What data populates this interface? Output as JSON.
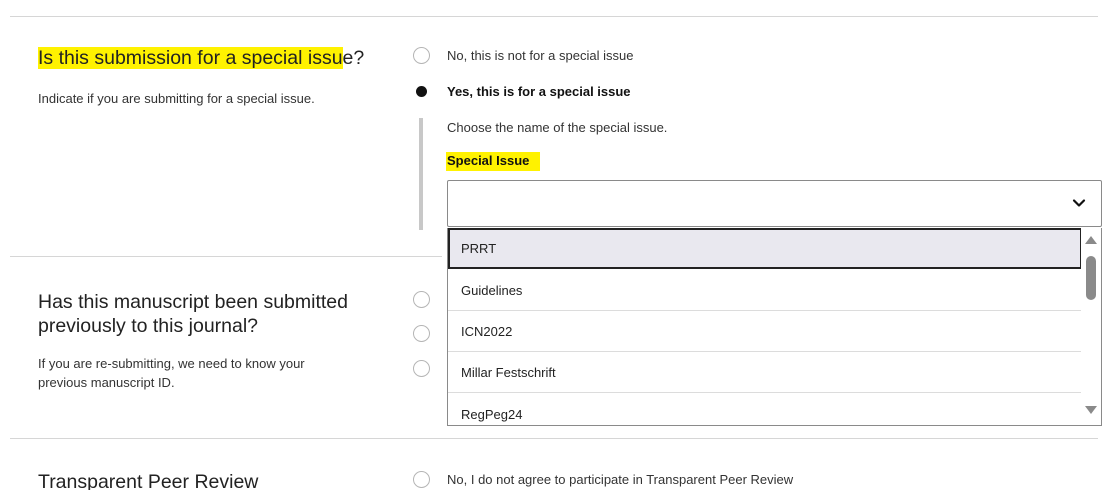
{
  "special_issue_question": {
    "title_highlighted": "Is this submission for a special issu",
    "title_rest": "e?",
    "description": "Indicate if you are submitting for a special issue.",
    "options": [
      {
        "label": "No, this is not for a special issue",
        "checked": false
      },
      {
        "label": "Yes, this is for a special issue",
        "checked": true
      }
    ],
    "choose_text": "Choose the name of the special issue.",
    "field_label": "Special Issue",
    "select_value": "",
    "dropdown_options": [
      "PRRT",
      "Guidelines",
      "ICN2022",
      "Millar Festschrift",
      "RegPeg24"
    ],
    "selected_option": "PRRT"
  },
  "previous_submission_question": {
    "title_line1": "Has this manuscript been submitted",
    "title_line2": "previously to this journal?",
    "description_line1": "If you are re-submitting, we need to know your",
    "description_line2": "previous manuscript ID."
  },
  "transparent_peer_review": {
    "title": "Transparent Peer Review",
    "option1": "No, I do not agree to participate in Transparent Peer Review"
  },
  "colors": {
    "highlight": "#fff200",
    "selected_option_bg": "#e9e8ef"
  },
  "icons": {
    "select_toggle": "chevron-down-icon",
    "scroll_up": "triangle-up-icon",
    "scroll_down": "triangle-down-icon"
  }
}
